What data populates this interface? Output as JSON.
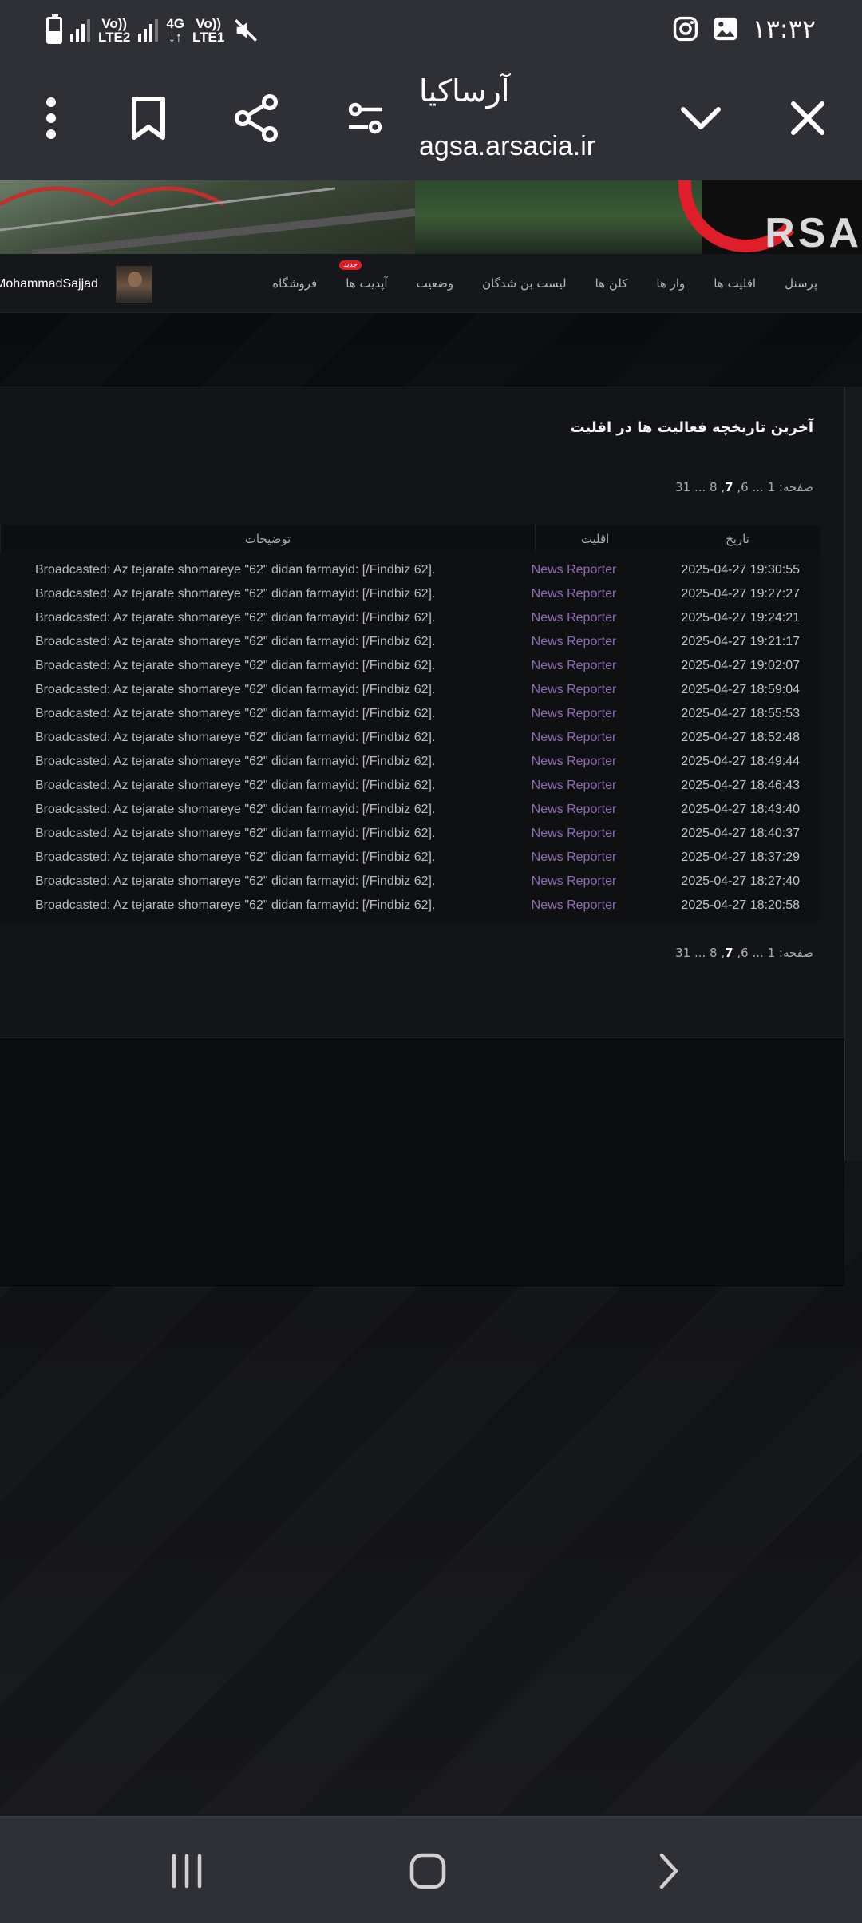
{
  "status_bar": {
    "left_labels": {
      "lte2_top": "Vo))",
      "lte2_bottom": "LTE2",
      "g4_top": "4G",
      "g4_bottom": "↓↑",
      "lte1_top": "Vo))",
      "lte1_bottom": "LTE1"
    },
    "time": "۱۳:۳۲",
    "battery_level": 0.45,
    "icons": [
      "battery-icon",
      "signal-icon",
      "mute-icon",
      "instagram-icon",
      "gallery-icon"
    ]
  },
  "browser": {
    "title": "آرساکیا",
    "url": "agsa.arsacia.ir",
    "icons": [
      "more-icon",
      "bookmark-icon",
      "share-icon",
      "settings-sliders-icon",
      "chevron-down-icon",
      "close-icon"
    ]
  },
  "site": {
    "logo_text": "RSA",
    "nav": [
      {
        "label": "پرسنل"
      },
      {
        "label": "اقلیت ها"
      },
      {
        "label": "وار ها"
      },
      {
        "label": "کلن ها"
      },
      {
        "label": "لیست بن شدگان"
      },
      {
        "label": "وضعیت"
      },
      {
        "label": "آپدیت ها",
        "badge": "جدید"
      },
      {
        "label": "فروشگاه"
      }
    ],
    "user_name": "MohammadSajjad"
  },
  "content": {
    "title": "آخرین تاریخچه فعالیت ها در اقلیت",
    "pager": {
      "label": "صفحه:",
      "first": "1",
      "ellipsis1": "...",
      "p6": "6",
      "p7": "7",
      "p8": "8",
      "ellipsis2": "...",
      "last": "31"
    },
    "table": {
      "headers": {
        "date": "تاریخ",
        "faction": "اقلیت",
        "desc": "توضیحات"
      },
      "rows": [
        {
          "date": "2025-04-27 19:30:55",
          "faction": "News Reporter",
          "desc": "Broadcasted: Az tejarate shomareye \"62\" didan farmayid: [/Findbiz 62]."
        },
        {
          "date": "2025-04-27 19:27:27",
          "faction": "News Reporter",
          "desc": "Broadcasted: Az tejarate shomareye \"62\" didan farmayid: [/Findbiz 62]."
        },
        {
          "date": "2025-04-27 19:24:21",
          "faction": "News Reporter",
          "desc": "Broadcasted: Az tejarate shomareye \"62\" didan farmayid: [/Findbiz 62]."
        },
        {
          "date": "2025-04-27 19:21:17",
          "faction": "News Reporter",
          "desc": "Broadcasted: Az tejarate shomareye \"62\" didan farmayid: [/Findbiz 62]."
        },
        {
          "date": "2025-04-27 19:02:07",
          "faction": "News Reporter",
          "desc": "Broadcasted: Az tejarate shomareye \"62\" didan farmayid: [/Findbiz 62]."
        },
        {
          "date": "2025-04-27 18:59:04",
          "faction": "News Reporter",
          "desc": "Broadcasted: Az tejarate shomareye \"62\" didan farmayid: [/Findbiz 62]."
        },
        {
          "date": "2025-04-27 18:55:53",
          "faction": "News Reporter",
          "desc": "Broadcasted: Az tejarate shomareye \"62\" didan farmayid: [/Findbiz 62]."
        },
        {
          "date": "2025-04-27 18:52:48",
          "faction": "News Reporter",
          "desc": "Broadcasted: Az tejarate shomareye \"62\" didan farmayid: [/Findbiz 62]."
        },
        {
          "date": "2025-04-27 18:49:44",
          "faction": "News Reporter",
          "desc": "Broadcasted: Az tejarate shomareye \"62\" didan farmayid: [/Findbiz 62]."
        },
        {
          "date": "2025-04-27 18:46:43",
          "faction": "News Reporter",
          "desc": "Broadcasted: Az tejarate shomareye \"62\" didan farmayid: [/Findbiz 62]."
        },
        {
          "date": "2025-04-27 18:43:40",
          "faction": "News Reporter",
          "desc": "Broadcasted: Az tejarate shomareye \"62\" didan farmayid: [/Findbiz 62]."
        },
        {
          "date": "2025-04-27 18:40:37",
          "faction": "News Reporter",
          "desc": "Broadcasted: Az tejarate shomareye \"62\" didan farmayid: [/Findbiz 62]."
        },
        {
          "date": "2025-04-27 18:37:29",
          "faction": "News Reporter",
          "desc": "Broadcasted: Az tejarate shomareye \"62\" didan farmayid: [/Findbiz 62]."
        },
        {
          "date": "2025-04-27 18:27:40",
          "faction": "News Reporter",
          "desc": "Broadcasted: Az tejarate shomareye \"62\" didan farmayid: [/Findbiz 62]."
        },
        {
          "date": "2025-04-27 18:20:58",
          "faction": "News Reporter",
          "desc": "Broadcasted: Az tejarate shomareye \"62\" didan farmayid: [/Findbiz 62]."
        }
      ]
    }
  },
  "system_nav": {
    "icons": [
      "recent-apps-icon",
      "home-icon",
      "back-icon"
    ]
  },
  "colors": {
    "faction": "#8e6bb3",
    "accent_red": "#e01e2a",
    "chrome": "#2e3035"
  }
}
